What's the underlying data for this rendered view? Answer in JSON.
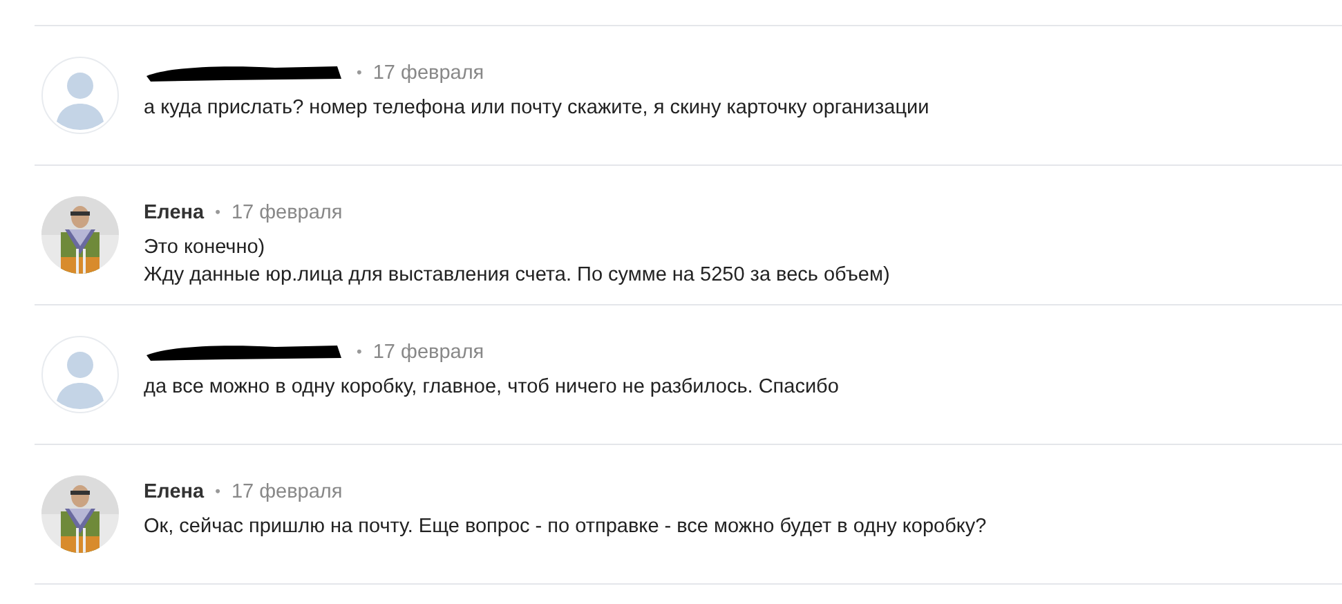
{
  "comments": [
    {
      "author": {
        "kind": "redacted"
      },
      "avatar": {
        "kind": "placeholder"
      },
      "separator": "•",
      "date": "17 февраля",
      "lines": [
        "а куда прислать? номер телефона или почту скажите, я скину карточку организации"
      ]
    },
    {
      "author": {
        "kind": "name",
        "name": "Елена"
      },
      "avatar": {
        "kind": "picture"
      },
      "separator": "•",
      "date": "17 февраля",
      "lines": [
        "Это конечно)",
        "Жду данные юр.лица для выставления счета. По сумме на 5250 за весь объем)"
      ]
    },
    {
      "author": {
        "kind": "redacted"
      },
      "avatar": {
        "kind": "placeholder"
      },
      "separator": "•",
      "date": "17 февраля",
      "lines": [
        "да все можно в одну коробку, главное, чтоб ничего не разбилось. Спасибо"
      ]
    },
    {
      "author": {
        "kind": "name",
        "name": "Елена"
      },
      "avatar": {
        "kind": "picture"
      },
      "separator": "•",
      "date": "17 февраля",
      "lines": [
        "Ок, сейчас пришлю на почту. Еще вопрос - по отправке - все можно будет в одну коробку?"
      ]
    }
  ]
}
